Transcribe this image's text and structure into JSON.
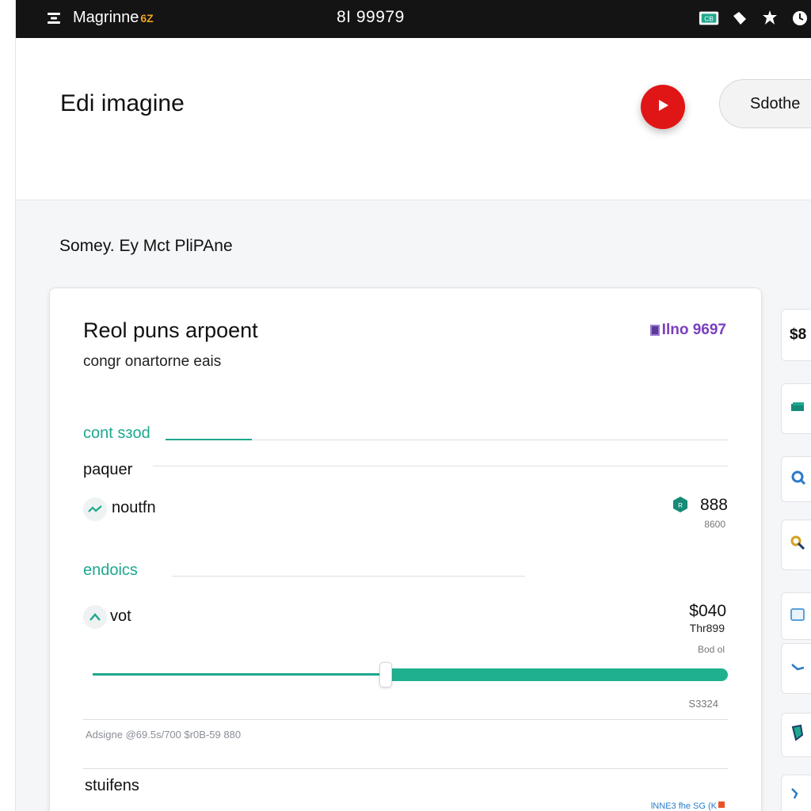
{
  "topbar": {
    "app_name": "Magrinne",
    "app_badge": "6Z",
    "center_text": "8I 99979"
  },
  "header": {
    "title": "Edi imagine",
    "pill_button": "Sdothe"
  },
  "subtitle": "Somey. Ey Mct PliPAne",
  "card": {
    "title": "Reol puns arpoent",
    "amount": "Ilno 9697",
    "subtitle": "congr onartorne eais",
    "section1": {
      "label": "cont sзod",
      "row1_label": "paquer",
      "row2_label": "noutfn",
      "row2_value": "888",
      "row2_sub": "8600"
    },
    "section2": {
      "label": "endoics",
      "row_label": "vot",
      "row_value": "$040",
      "row_sub": "Thr899",
      "slider_top_note": "Bod ol",
      "slider_bottom_note": "S3324",
      "slider_position_percent": 41
    },
    "footnote": "Adsigne @69.5s/700 $r0B-59 880",
    "bottom_label": "stuifens",
    "corner_note": "lNNE3 fhe SG (K"
  },
  "side_column": {
    "tile1_text": "$8"
  },
  "icons": {
    "menu": "menu-icon",
    "play": "play-icon",
    "tray": [
      "battery-icon",
      "tag-icon",
      "settings-icon",
      "clock-icon"
    ]
  },
  "colors": {
    "accent": "#1ea88e",
    "play": "#e01616",
    "amount": "#7a3fc0",
    "topbar": "#141414"
  }
}
